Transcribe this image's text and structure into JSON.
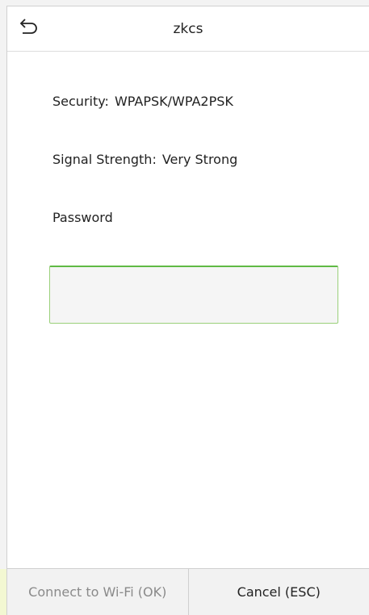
{
  "header": {
    "title": "zkcs",
    "back_icon": "back-arrow-icon"
  },
  "details": {
    "security_label": "Security:",
    "security_value": "WPAPSK/WPA2PSK",
    "signal_label": "Signal Strength:",
    "signal_value": "Very Strong",
    "password_label": "Password"
  },
  "password_input": {
    "value": "",
    "placeholder": ""
  },
  "footer": {
    "connect_label": "Connect to Wi-Fi (OK)",
    "cancel_label": "Cancel (ESC)"
  },
  "colors": {
    "input_focus_border": "#5fba44",
    "disabled_text": "#8a8a8a"
  }
}
